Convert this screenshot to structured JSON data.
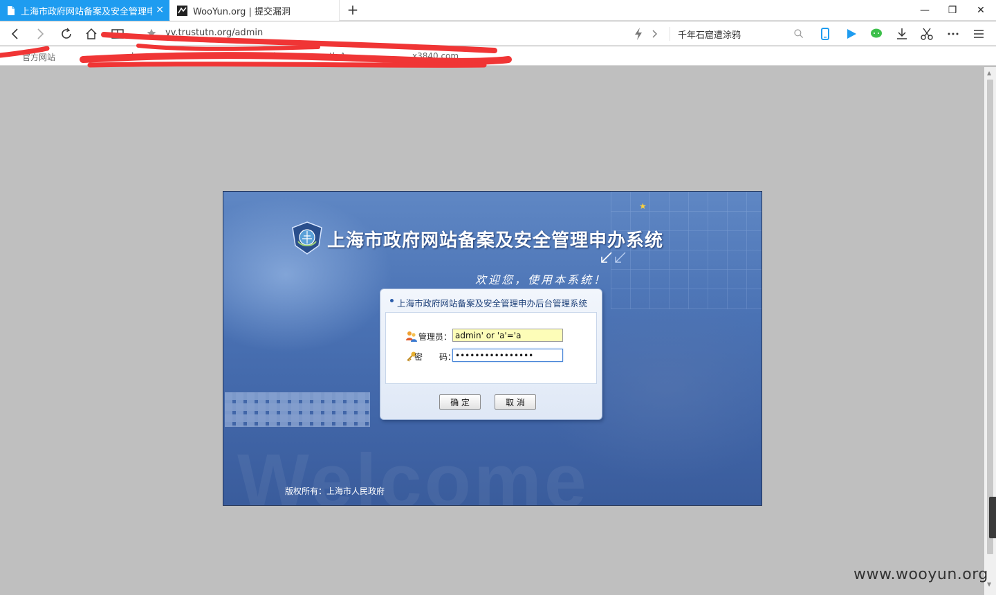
{
  "tabs": [
    {
      "title": "上海市政府网站备案及安全管理申办",
      "close_label": "×"
    },
    {
      "title": "WooYun.org | 提交漏洞"
    }
  ],
  "new_tab_label": "+",
  "window_controls": {
    "minimize": "—",
    "restore": "❐",
    "close": "✕"
  },
  "address_bar": {
    "url": "yv.trustutn.org/admin"
  },
  "search_box": {
    "value": "千年石窟遭涂鸦"
  },
  "bookmarks": {
    "visible_fragment_1": "官方网站",
    "visible_fragment_2": "l",
    "visible_fragment_3": "i.com",
    "visible_fragment_4": "tk A",
    "visible_fragment_5": "x3840.com"
  },
  "icons": [
    "back-icon",
    "forward-icon",
    "refresh-icon",
    "home-icon",
    "reader-icon",
    "star-icon",
    "lightning-icon",
    "chevron-right-icon",
    "search-icon",
    "phone-icon",
    "play-icon",
    "chat-icon",
    "download-icon",
    "scissors-icon",
    "more-icon",
    "menu-icon"
  ],
  "login": {
    "system_title": "上海市政府网站备案及安全管理申办系统",
    "greeting": "欢迎您，使用本系统！",
    "panel_title": "上海市政府网站备案及安全管理申办后台管理系统",
    "username_label": "管理员：",
    "username_value": "admin' or 'a'='a",
    "password_label": "密　　码：",
    "password_value": "••••••••••••••••",
    "confirm_button": "确 定",
    "cancel_button": "取 消",
    "copyright": "版权所有：上海市人民政府",
    "background_text": "Welcome"
  },
  "watermark": "www.wooyun.org",
  "colors": {
    "tab_active": "#1e9cf0",
    "page_bg": "#bfbfbf",
    "panel_title": "#1c3f78",
    "username_field_bg": "#fdfdb8",
    "scribble": "#f03535"
  }
}
